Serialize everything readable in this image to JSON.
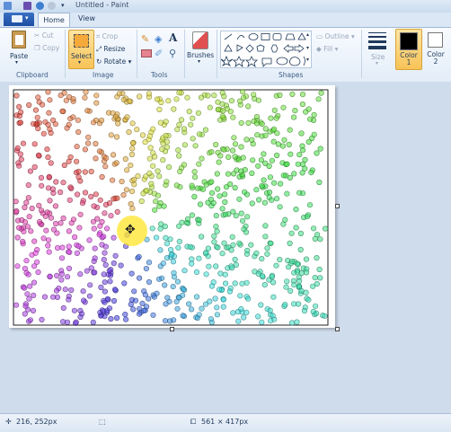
{
  "window": {
    "title": "Untitled - Paint"
  },
  "tabs": [
    {
      "label": "Home"
    },
    {
      "label": "View"
    }
  ],
  "clipboard": {
    "paste": "Paste",
    "cut": "Cut",
    "copy": "Copy",
    "label": "Clipboard"
  },
  "image": {
    "select": "Select",
    "crop": "Crop",
    "resize": "Resize",
    "rotate": "Rotate",
    "label": "Image"
  },
  "tools": {
    "label": "Tools"
  },
  "brushes": {
    "label": "Brushes"
  },
  "shapes": {
    "outline": "Outline",
    "fill": "Fill",
    "label": "Shapes"
  },
  "size": {
    "label": "Size"
  },
  "colors": {
    "color1_label": "Color",
    "color1_num": "1",
    "color2_label": "Color",
    "color2_num": "2",
    "color1": "#000000",
    "color2": "#ffffff"
  },
  "status": {
    "cursor_pos": "216, 252px",
    "canvas_size": "561 × 417px"
  }
}
